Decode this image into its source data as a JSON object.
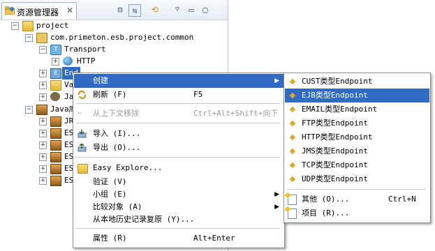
{
  "panel": {
    "tab_label": "资源管理器",
    "tab_close": "✕",
    "header_buttons": [
      {
        "name": "collapse-all-icon",
        "glyph": "⊟"
      },
      {
        "name": "link-editor-icon",
        "glyph": "⇆"
      },
      {
        "name": "sync-icon",
        "glyph": "⟲"
      },
      {
        "name": "view-menu-icon",
        "glyph": "▽"
      },
      {
        "name": "minimize-icon",
        "glyph": "▭"
      },
      {
        "name": "maximize-icon",
        "glyph": "▢"
      }
    ]
  },
  "tree": {
    "project": "project",
    "module": "com.primeton.esb.project.common",
    "transport": "Transport",
    "http": "HTTP",
    "endpoint_partial": "End",
    "va_partial": "Va",
    "ja_partial": "Ja",
    "java_lib": "Java库",
    "jr_partial": "JR",
    "es1": "ES",
    "es2": "ES",
    "es3": "ES",
    "es4": "ES",
    "es5": "ES"
  },
  "context_menu": {
    "create": "创建",
    "refresh": "刷新 (F)",
    "refresh_key": "F5",
    "remove_context": "从上下文移除",
    "remove_context_key": "Ctrl+Alt+Shift+向下",
    "import": "导入 (I)...",
    "export": "导出 (O)...",
    "easy_explore": "Easy Explore...",
    "validate": "验证 (V)",
    "team": "小组 (E)",
    "compare": "比较对象 (A)",
    "restore": "从本地历史记录复原 (Y)...",
    "properties": "属性 (R)",
    "properties_key": "Alt+Enter"
  },
  "submenu": {
    "items": [
      "CUST类型Endpoint",
      "EJB类型Endpoint",
      "EMAIL类型Endpoint",
      "FTP类型Endpoint",
      "HTTP类型Endpoint",
      "JMS类型Endpoint",
      "TCP类型Endpoint",
      "UDP类型Endpoint"
    ],
    "other": "其他 (O)...",
    "other_key": "Ctrl+N",
    "project": "项目 (R)..."
  },
  "colors": {
    "selection": "#316ac5",
    "panel_border": "#b9c7d6"
  }
}
